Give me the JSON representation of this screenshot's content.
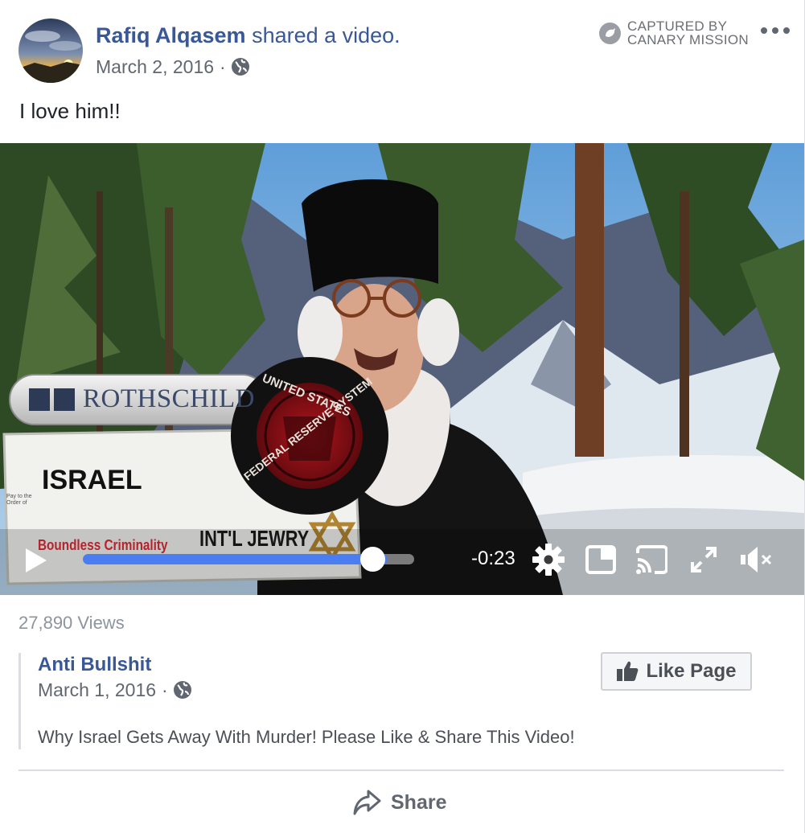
{
  "post": {
    "author": "Rafiq Alqasem",
    "action": " shared a video.",
    "date": "March 2, 2016",
    "separator": "·",
    "text": "I love him!!",
    "captured_line1": "CAPTURED BY",
    "captured_line2": "CANARY MISSION",
    "icons": {
      "privacy": "globe-icon",
      "menu": "more-options-icon",
      "badge": "canary-mission-icon"
    }
  },
  "video": {
    "overlay_text": {
      "rothschild": "ROTHSCHILD",
      "seal_top": "UNITED STATES",
      "seal_bottom": "FEDERAL RESERVE SYSTEM",
      "check_payee": "ISRAEL",
      "check_memo": "Boundless Criminality",
      "check_signature": "INT'L JEWRY",
      "check_pay_to": "Pay to the Order of"
    },
    "progress_fraction": 0.92,
    "time_remaining": "-0:23",
    "icons": [
      "play-icon",
      "settings-icon",
      "picture-in-picture-icon",
      "cast-icon",
      "fullscreen-icon",
      "muted-icon"
    ]
  },
  "views": "27,890 Views",
  "shared_page": {
    "name": "Anti Bullshit",
    "date": "March 1, 2016",
    "separator": "·",
    "like_button": "Like Page",
    "description": "Why Israel Gets Away With Murder! Please Like & Share This Video!"
  },
  "actions": {
    "share": "Share"
  },
  "colors": {
    "link": "#385898",
    "meta": "#616770",
    "progress": "#4a7ef0"
  }
}
